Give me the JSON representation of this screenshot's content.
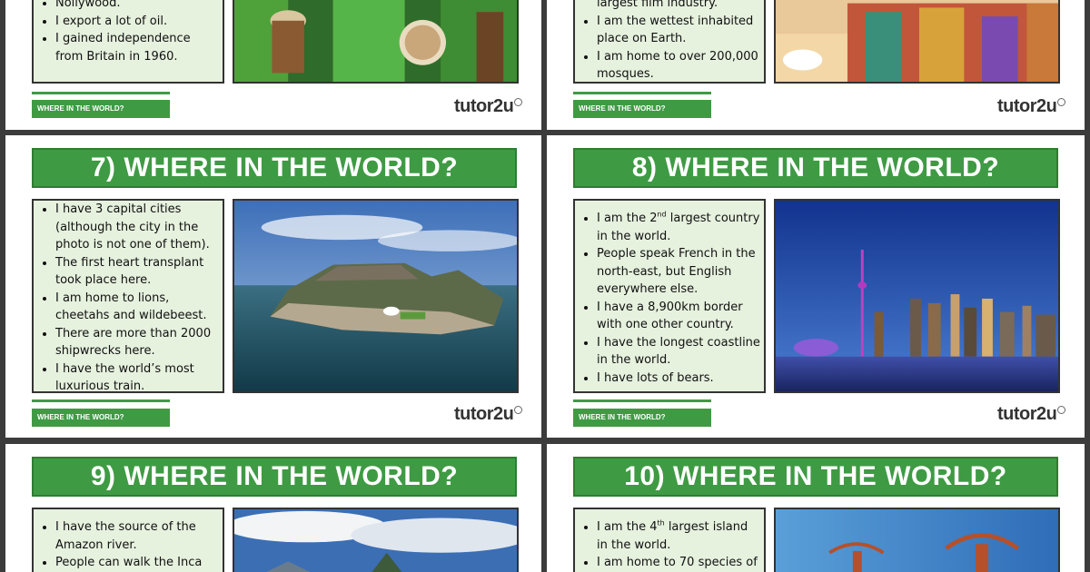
{
  "footer_tag": "WHERE IN THE WORLD?",
  "brand": "tutor2u",
  "colors": {
    "accent": "#3f9a44",
    "fact_bg": "#e6f1de",
    "page_bg": "#3c3c3c"
  },
  "card5": {
    "facts": [
      "Nollywood.",
      "I export a lot of oil.",
      "I gained independence from Britain in 1960."
    ]
  },
  "card6": {
    "facts": [
      "largest film industry.",
      "I am the wettest inhabited place on Earth.",
      "I am home to over 200,000 mosques."
    ]
  },
  "card7": {
    "title": "7) WHERE IN THE WORLD?",
    "facts": [
      "I have 3 capital cities (although the city in the photo is not one of them).",
      "The first heart transplant took place here.",
      "I am home to lions, cheetahs and wildebeest.",
      "There are more than 2000 shipwrecks here.",
      "I have the world’s most luxurious train."
    ]
  },
  "card8": {
    "title": "8) WHERE IN THE WORLD?",
    "facts": [
      "I am the 2nd largest country in the world.",
      "People speak French in the north-east, but English everywhere else.",
      "I have a 8,900km border with one other country.",
      "I have the longest coastline in the world.",
      "I have lots of bears."
    ]
  },
  "card9": {
    "title": "9) WHERE IN THE WORLD?",
    "facts": [
      "I have the source of the Amazon river.",
      "People can walk the Inca"
    ]
  },
  "card10": {
    "title": "10) WHERE IN THE WORLD?",
    "facts": [
      "I am the 4th largest island in the world.",
      "I am home to 70 species of"
    ]
  }
}
